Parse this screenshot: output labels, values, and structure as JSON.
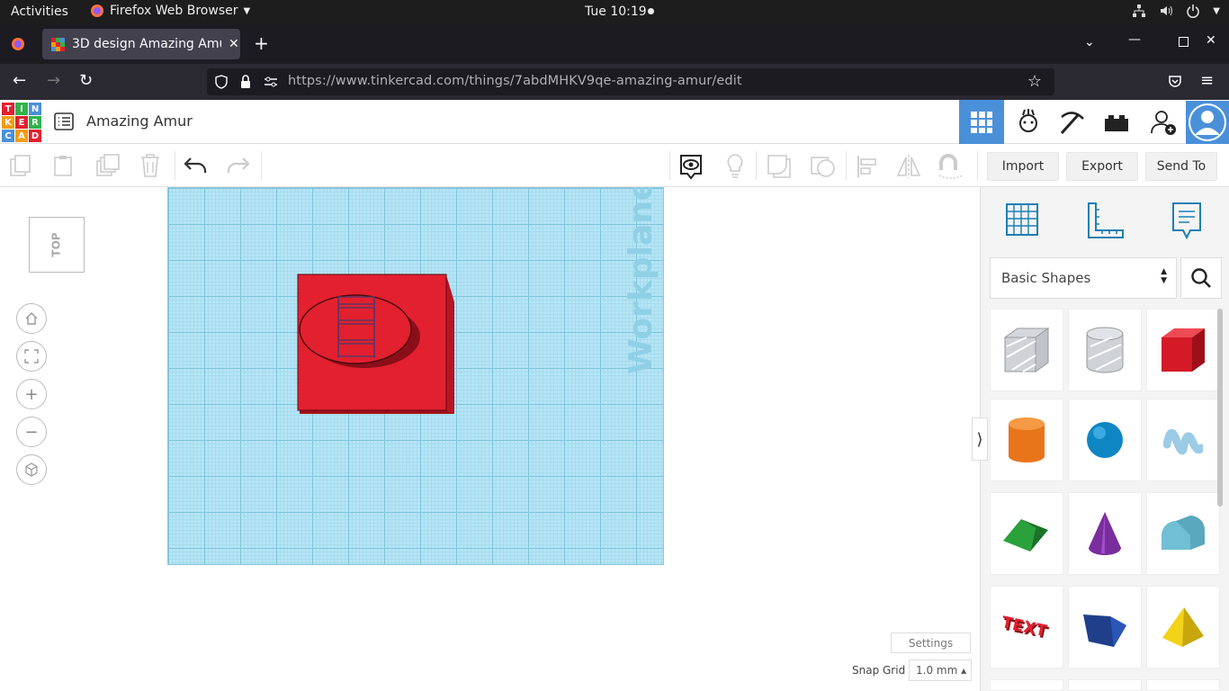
{
  "gnome": {
    "activities": "Activities",
    "app_name": "Firefox Web Browser",
    "clock": "Tue 10:19"
  },
  "browser": {
    "tab_title": "3D design Amazing Amur",
    "url_host": "https://www.tinkercad.com",
    "url_path": "/things/7abdMHKV9qe-amazing-amur/edit"
  },
  "tinkercad": {
    "logo_letters": [
      "T",
      "I",
      "N",
      "K",
      "E",
      "R",
      "C",
      "A",
      "D"
    ],
    "design_name": "Amazing Amur",
    "toolbar": {
      "import": "Import",
      "export": "Export",
      "send_to": "Send To"
    },
    "view_cube": "TOP",
    "workplane_label": "Workplane",
    "panel": {
      "shape_category": "Basic Shapes"
    },
    "settings": "Settings",
    "snap_grid_label": "Snap Grid",
    "snap_grid_value": "1.0 mm ▴"
  },
  "colors": {
    "accent": "#4a90d9",
    "shape_red": "#e2202f"
  }
}
